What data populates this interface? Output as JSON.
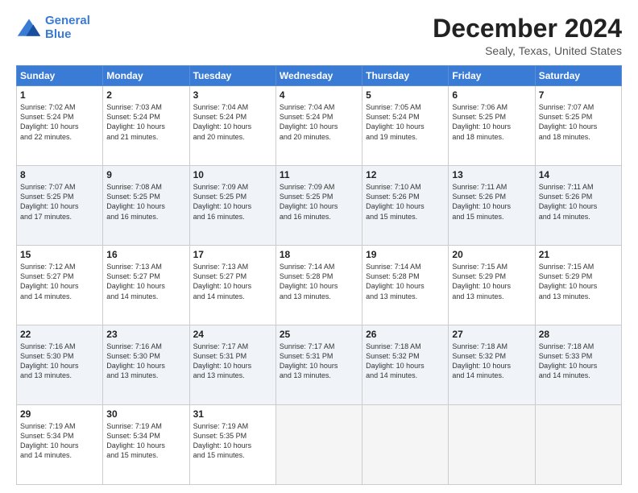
{
  "header": {
    "logo_line1": "General",
    "logo_line2": "Blue",
    "month": "December 2024",
    "location": "Sealy, Texas, United States"
  },
  "days_of_week": [
    "Sunday",
    "Monday",
    "Tuesday",
    "Wednesday",
    "Thursday",
    "Friday",
    "Saturday"
  ],
  "weeks": [
    [
      {
        "day": "1",
        "info": "Sunrise: 7:02 AM\nSunset: 5:24 PM\nDaylight: 10 hours\nand 22 minutes."
      },
      {
        "day": "2",
        "info": "Sunrise: 7:03 AM\nSunset: 5:24 PM\nDaylight: 10 hours\nand 21 minutes."
      },
      {
        "day": "3",
        "info": "Sunrise: 7:04 AM\nSunset: 5:24 PM\nDaylight: 10 hours\nand 20 minutes."
      },
      {
        "day": "4",
        "info": "Sunrise: 7:04 AM\nSunset: 5:24 PM\nDaylight: 10 hours\nand 20 minutes."
      },
      {
        "day": "5",
        "info": "Sunrise: 7:05 AM\nSunset: 5:24 PM\nDaylight: 10 hours\nand 19 minutes."
      },
      {
        "day": "6",
        "info": "Sunrise: 7:06 AM\nSunset: 5:25 PM\nDaylight: 10 hours\nand 18 minutes."
      },
      {
        "day": "7",
        "info": "Sunrise: 7:07 AM\nSunset: 5:25 PM\nDaylight: 10 hours\nand 18 minutes."
      }
    ],
    [
      {
        "day": "8",
        "info": "Sunrise: 7:07 AM\nSunset: 5:25 PM\nDaylight: 10 hours\nand 17 minutes."
      },
      {
        "day": "9",
        "info": "Sunrise: 7:08 AM\nSunset: 5:25 PM\nDaylight: 10 hours\nand 16 minutes."
      },
      {
        "day": "10",
        "info": "Sunrise: 7:09 AM\nSunset: 5:25 PM\nDaylight: 10 hours\nand 16 minutes."
      },
      {
        "day": "11",
        "info": "Sunrise: 7:09 AM\nSunset: 5:25 PM\nDaylight: 10 hours\nand 16 minutes."
      },
      {
        "day": "12",
        "info": "Sunrise: 7:10 AM\nSunset: 5:26 PM\nDaylight: 10 hours\nand 15 minutes."
      },
      {
        "day": "13",
        "info": "Sunrise: 7:11 AM\nSunset: 5:26 PM\nDaylight: 10 hours\nand 15 minutes."
      },
      {
        "day": "14",
        "info": "Sunrise: 7:11 AM\nSunset: 5:26 PM\nDaylight: 10 hours\nand 14 minutes."
      }
    ],
    [
      {
        "day": "15",
        "info": "Sunrise: 7:12 AM\nSunset: 5:27 PM\nDaylight: 10 hours\nand 14 minutes."
      },
      {
        "day": "16",
        "info": "Sunrise: 7:13 AM\nSunset: 5:27 PM\nDaylight: 10 hours\nand 14 minutes."
      },
      {
        "day": "17",
        "info": "Sunrise: 7:13 AM\nSunset: 5:27 PM\nDaylight: 10 hours\nand 14 minutes."
      },
      {
        "day": "18",
        "info": "Sunrise: 7:14 AM\nSunset: 5:28 PM\nDaylight: 10 hours\nand 13 minutes."
      },
      {
        "day": "19",
        "info": "Sunrise: 7:14 AM\nSunset: 5:28 PM\nDaylight: 10 hours\nand 13 minutes."
      },
      {
        "day": "20",
        "info": "Sunrise: 7:15 AM\nSunset: 5:29 PM\nDaylight: 10 hours\nand 13 minutes."
      },
      {
        "day": "21",
        "info": "Sunrise: 7:15 AM\nSunset: 5:29 PM\nDaylight: 10 hours\nand 13 minutes."
      }
    ],
    [
      {
        "day": "22",
        "info": "Sunrise: 7:16 AM\nSunset: 5:30 PM\nDaylight: 10 hours\nand 13 minutes."
      },
      {
        "day": "23",
        "info": "Sunrise: 7:16 AM\nSunset: 5:30 PM\nDaylight: 10 hours\nand 13 minutes."
      },
      {
        "day": "24",
        "info": "Sunrise: 7:17 AM\nSunset: 5:31 PM\nDaylight: 10 hours\nand 13 minutes."
      },
      {
        "day": "25",
        "info": "Sunrise: 7:17 AM\nSunset: 5:31 PM\nDaylight: 10 hours\nand 13 minutes."
      },
      {
        "day": "26",
        "info": "Sunrise: 7:18 AM\nSunset: 5:32 PM\nDaylight: 10 hours\nand 14 minutes."
      },
      {
        "day": "27",
        "info": "Sunrise: 7:18 AM\nSunset: 5:32 PM\nDaylight: 10 hours\nand 14 minutes."
      },
      {
        "day": "28",
        "info": "Sunrise: 7:18 AM\nSunset: 5:33 PM\nDaylight: 10 hours\nand 14 minutes."
      }
    ],
    [
      {
        "day": "29",
        "info": "Sunrise: 7:19 AM\nSunset: 5:34 PM\nDaylight: 10 hours\nand 14 minutes."
      },
      {
        "day": "30",
        "info": "Sunrise: 7:19 AM\nSunset: 5:34 PM\nDaylight: 10 hours\nand 15 minutes."
      },
      {
        "day": "31",
        "info": "Sunrise: 7:19 AM\nSunset: 5:35 PM\nDaylight: 10 hours\nand 15 minutes."
      },
      null,
      null,
      null,
      null
    ]
  ]
}
